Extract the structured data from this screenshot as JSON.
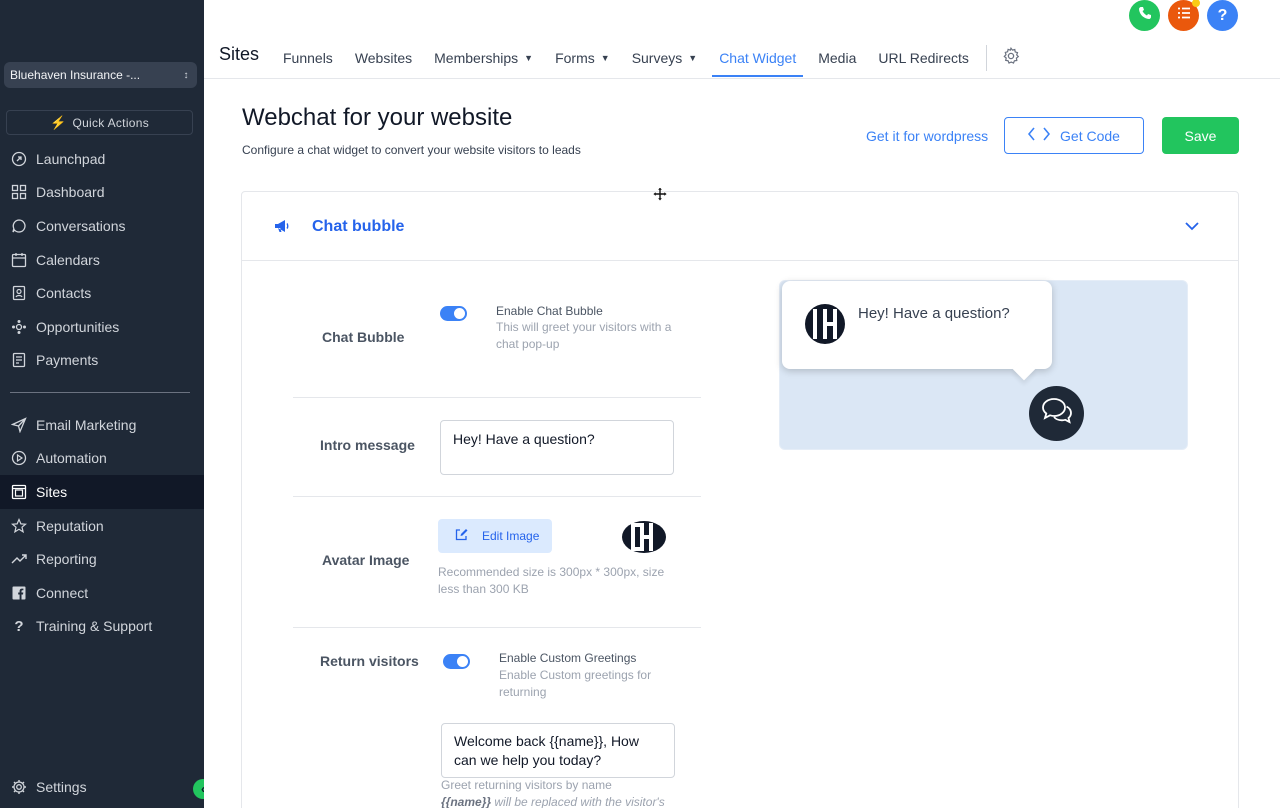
{
  "sidebar": {
    "account": "Bluehaven Insurance -...",
    "quick_actions": "Quick Actions",
    "items_top": [
      {
        "label": "Launchpad",
        "icon": "launchpad-icon"
      },
      {
        "label": "Dashboard",
        "icon": "dashboard-icon"
      },
      {
        "label": "Conversations",
        "icon": "conversations-icon"
      },
      {
        "label": "Calendars",
        "icon": "calendar-icon"
      },
      {
        "label": "Contacts",
        "icon": "contacts-icon"
      },
      {
        "label": "Opportunities",
        "icon": "opportunities-icon"
      },
      {
        "label": "Payments",
        "icon": "payments-icon"
      }
    ],
    "items_bottom": [
      {
        "label": "Email Marketing",
        "icon": "send-icon"
      },
      {
        "label": "Automation",
        "icon": "automation-icon"
      },
      {
        "label": "Sites",
        "icon": "sites-icon",
        "active": true
      },
      {
        "label": "Reputation",
        "icon": "star-icon"
      },
      {
        "label": "Reporting",
        "icon": "chart-line-icon"
      },
      {
        "label": "Connect",
        "icon": "facebook-icon"
      },
      {
        "label": "Training & Support",
        "icon": "question-icon"
      }
    ],
    "settings": "Settings"
  },
  "topbar": {
    "title": "Sites",
    "tabs": [
      {
        "label": "Funnels",
        "dropdown": false
      },
      {
        "label": "Websites",
        "dropdown": false
      },
      {
        "label": "Memberships",
        "dropdown": true
      },
      {
        "label": "Forms",
        "dropdown": true
      },
      {
        "label": "Surveys",
        "dropdown": true
      },
      {
        "label": "Chat Widget",
        "dropdown": false,
        "active": true
      },
      {
        "label": "Media",
        "dropdown": false
      },
      {
        "label": "URL Redirects",
        "dropdown": false
      }
    ],
    "help_glyph": "?"
  },
  "page": {
    "title": "Webchat for your website",
    "subtitle": "Configure a chat widget to convert your website visitors to leads",
    "wordpress_link": "Get it for wordpress",
    "get_code": "Get Code",
    "save": "Save"
  },
  "chat_bubble_section": {
    "title": "Chat bubble",
    "chat_bubble": {
      "label": "Chat Bubble",
      "toggle_title": "Enable Chat Bubble",
      "toggle_desc": "This will greet your visitors with a chat pop-up",
      "enabled": true
    },
    "intro_message": {
      "label": "Intro message",
      "value": "Hey! Have a question?"
    },
    "avatar_image": {
      "label": "Avatar Image",
      "edit_button": "Edit Image",
      "hint": "Recommended size is 300px * 300px, size less than 300 KB"
    },
    "return_visitors": {
      "label": "Return visitors",
      "toggle_title": "Enable Custom Greetings",
      "toggle_desc": "Enable Custom greetings for returning",
      "enabled": true,
      "greeting_value": "Welcome back {{name}}, How can we help you today?",
      "help_prefix": "Greet returning visitors by name",
      "help_token": "{{name}}",
      "help_suffix": " will be replaced with the visitor's"
    },
    "preview": {
      "message": "Hey! Have a question?"
    }
  },
  "colors": {
    "sidebar_bg": "#1f2937",
    "accent_blue": "#3b82f6",
    "save_green": "#22c55e",
    "phone_green": "#22c55e",
    "list_orange": "#ea580c",
    "preview_bg": "#dbe7f5"
  }
}
